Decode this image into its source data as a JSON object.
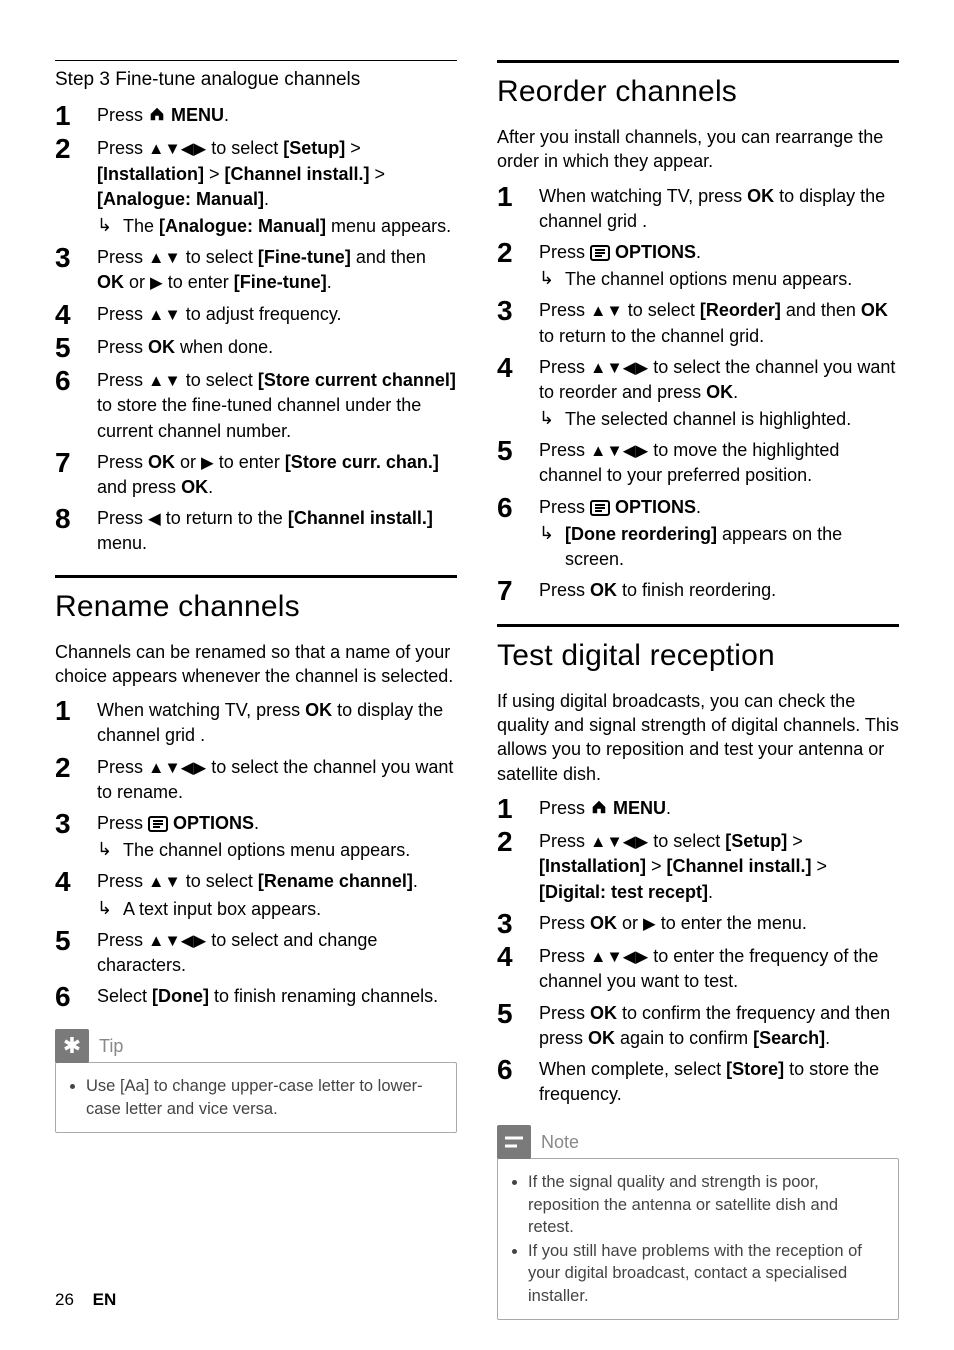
{
  "left": {
    "sub1_title": "Step 3 Fine-tune analogue channels",
    "s1": {
      "n1": "1",
      "t1a": "Press ",
      "t1b": " MENU",
      "n2": "2",
      "t2a": "Press ",
      "t2b": " to select ",
      "t2c": "[Setup]",
      "t2d": " > ",
      "t2e": "[Installation]",
      "t2f": " > ",
      "t2g": "[Channel install.]",
      "t2h": " > ",
      "t2i": "[Analogue: Manual]",
      "t2j": ".",
      "t2k": "The ",
      "t2l": "[Analogue: Manual]",
      "t2m": " menu appears.",
      "n3": "3",
      "t3a": "Press ",
      "t3b": " to select ",
      "t3c": "[Fine-tune]",
      "t3d": " and then ",
      "t3e": "OK",
      "t3f": " or ",
      "t3g": " to enter ",
      "t3h": "[Fine-tune]",
      "t3i": ".",
      "n4": "4",
      "t4a": "Press ",
      "t4b": " to adjust frequency.",
      "n5": "5",
      "t5a": "Press ",
      "t5b": "OK",
      "t5c": " when done.",
      "n6": "6",
      "t6a": "Press ",
      "t6b": " to select ",
      "t6c": "[Store current channel]",
      "t6d": " to store the fine-tuned channel under the current channel number.",
      "n7": "7",
      "t7a": "Press ",
      "t7b": "OK",
      "t7c": " or ",
      "t7d": " to enter ",
      "t7e": "[Store curr. chan.]",
      "t7f": " and press ",
      "t7g": "OK",
      "t7h": ".",
      "n8": "8",
      "t8a": "Press ",
      "t8b": " to return to the ",
      "t8c": "[Channel install.]",
      "t8d": " menu."
    },
    "h2_rename": "Rename channels",
    "rename_intro": "Channels can be renamed so that a name of your choice appears whenever the channel is selected.",
    "s2": {
      "n1": "1",
      "t1a": "When watching TV, press ",
      "t1b": "OK",
      "t1c": " to display the channel grid .",
      "n2": "2",
      "t2a": "Press ",
      "t2b": " to select the channel you want to rename.",
      "n3": "3",
      "t3a": "Press ",
      "t3b": " OPTIONS",
      "t3c": "The channel options menu appears.",
      "n4": "4",
      "t4a": "Press ",
      "t4b": " to select ",
      "t4c": "[Rename channel]",
      "t4d": ".",
      "t4e": "A text input box appears.",
      "n5": "5",
      "t5a": "Press ",
      "t5b": " to select and change characters.",
      "n6": "6",
      "t6a": "Select ",
      "t6b": "[Done]",
      "t6c": " to finish renaming channels."
    },
    "tip_label": "Tip",
    "tip_body_a": "Use ",
    "tip_body_b": "[Aa]",
    "tip_body_c": " to change upper-case letter to lower-case letter and vice versa."
  },
  "right": {
    "h2_reorder": "Reorder channels",
    "reorder_intro": "After you install channels, you can rearrange the order in which they appear.",
    "s1": {
      "n1": "1",
      "t1a": "When watching TV, press ",
      "t1b": "OK",
      "t1c": " to display the channel grid .",
      "n2": "2",
      "t2a": "Press ",
      "t2b": " OPTIONS",
      "t2c": "The channel options menu appears.",
      "n3": "3",
      "t3a": "Press ",
      "t3b": " to select ",
      "t3c": "[Reorder]",
      "t3d": " and then ",
      "t3e": "OK",
      "t3f": " to return to the channel grid.",
      "n4": "4",
      "t4a": "Press ",
      "t4b": " to select the channel you want to reorder and press ",
      "t4c": "OK",
      "t4d": ".",
      "t4e": "The selected channel is highlighted.",
      "n5": "5",
      "t5a": "Press ",
      "t5b": " to move the highlighted channel to your preferred position.",
      "n6": "6",
      "t6a": "Press ",
      "t6b": " OPTIONS",
      "t6c": "[Done reordering]",
      "t6d": " appears on the screen.",
      "n7": "7",
      "t7a": "Press ",
      "t7b": "OK",
      "t7c": " to finish reordering."
    },
    "h2_test": "Test digital reception",
    "test_intro": "If using digital broadcasts, you can check the quality and signal strength of digital channels. This allows you to reposition and test your antenna or satellite dish.",
    "s2": {
      "n1": "1",
      "t1a": "Press ",
      "t1b": " MENU",
      "n2": "2",
      "t2a": "Press ",
      "t2b": " to select ",
      "t2c": "[Setup]",
      "t2d": " > ",
      "t2e": "[Installation]",
      "t2f": " > ",
      "t2g": "[Channel install.]",
      "t2h": " > ",
      "t2i": "[Digital: test recept]",
      "t2j": ".",
      "n3": "3",
      "t3a": "Press ",
      "t3b": "OK",
      "t3c": " or ",
      "t3d": " to enter the menu.",
      "n4": "4",
      "t4a": "Press ",
      "t4b": " to enter the frequency of the channel you want to test.",
      "n5": "5",
      "t5a": "Press ",
      "t5b": "OK",
      "t5c": " to confirm the frequency and then press ",
      "t5d": "OK",
      "t5e": " again to confirm ",
      "t5f": "[Search]",
      "t5g": ".",
      "n6": "6",
      "t6a": "When complete, select ",
      "t6b": "[Store]",
      "t6c": " to store the frequency."
    },
    "note_label": "Note",
    "note_b1": "If the signal quality and strength is poor, reposition the antenna or satellite dish and retest.",
    "note_b2": "If you still have problems with the reception of your digital broadcast, contact a specialised installer."
  },
  "footer": {
    "page": "26",
    "lang": "EN"
  }
}
